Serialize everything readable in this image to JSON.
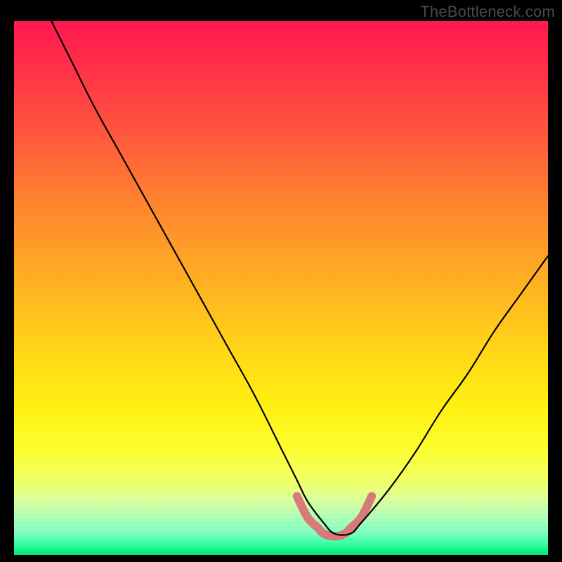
{
  "watermark": "TheBottleneck.com",
  "chart_data": {
    "type": "line",
    "title": "",
    "xlabel": "",
    "ylabel": "",
    "xlim": [
      0,
      100
    ],
    "ylim": [
      0,
      100
    ],
    "grid": false,
    "series": [
      {
        "name": "bottleneck-curve",
        "color": "#000000",
        "x": [
          7,
          11,
          15,
          20,
          25,
          30,
          35,
          40,
          45,
          50,
          53,
          55,
          58,
          60,
          63,
          65,
          70,
          75,
          80,
          85,
          90,
          95,
          100
        ],
        "values": [
          100,
          92,
          84,
          75,
          66,
          57,
          48,
          39,
          30,
          20,
          14,
          10,
          6,
          4,
          4,
          6,
          12,
          19,
          27,
          34,
          42,
          49,
          56
        ]
      }
    ],
    "annotations": [
      {
        "name": "optimal-zone",
        "type": "segment",
        "color": "#d87a78",
        "x": [
          53,
          55,
          57,
          58,
          60,
          62,
          63,
          65,
          67
        ],
        "values": [
          11,
          7,
          5,
          4,
          3.5,
          4,
          5,
          7,
          11
        ]
      }
    ],
    "background": {
      "type": "vertical-gradient",
      "stops": [
        {
          "pos": 0.0,
          "color": "#ff1850"
        },
        {
          "pos": 0.22,
          "color": "#ff5a3c"
        },
        {
          "pos": 0.5,
          "color": "#ffb321"
        },
        {
          "pos": 0.72,
          "color": "#fff011"
        },
        {
          "pos": 0.9,
          "color": "#d7ffa0"
        },
        {
          "pos": 1.0,
          "color": "#00e878"
        }
      ]
    }
  }
}
